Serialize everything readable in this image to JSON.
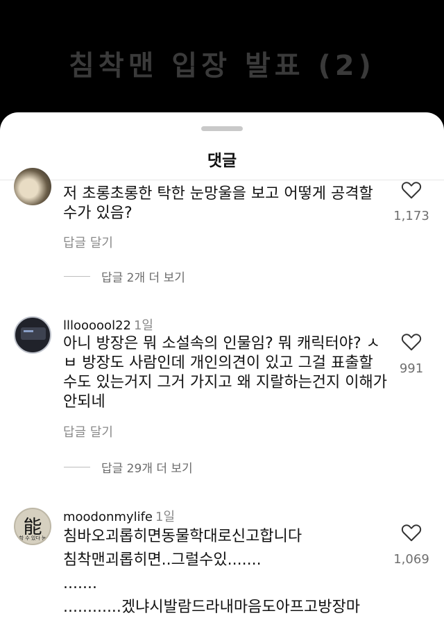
{
  "video": {
    "title": "침착맨 입장 발표 (2)"
  },
  "sheet": {
    "title": "댓글"
  },
  "comments": [
    {
      "username": "",
      "time": "",
      "text": "저 초롱초롱한 탁한 눈망울을 보고 어떻게 공격할 수가 있음?",
      "reply_label": "답글 달기",
      "likes": "1,173",
      "more_replies": "답글 2개 더 보기"
    },
    {
      "username": "llloooool22",
      "time": "1일",
      "text": "아니 방장은 뭐 소설속의 인물임? 뭐 캐릭터야? ㅅㅂ 방장도 사람인데 개인의견이 있고 그걸 표출할 수도 있는거지 그거 가지고 왜 지랄하는건지 이해가 안되네",
      "reply_label": "답글 달기",
      "likes": "991",
      "more_replies": "답글 29개 더 보기"
    },
    {
      "username": "moodonmylife",
      "time": "1일",
      "text_lines": [
        "침바오괴롭히면동물학대로신고합니다",
        "침착맨괴롭히면..그럴수있.......",
        ".......",
        "............겠냐시발람드라내마음도아프고방장마"
      ],
      "likes": "1,069",
      "avatar_glyph": "能",
      "avatar_caption": "할 수 있다 능"
    }
  ],
  "icons": {
    "like": "heart-outline-icon"
  }
}
